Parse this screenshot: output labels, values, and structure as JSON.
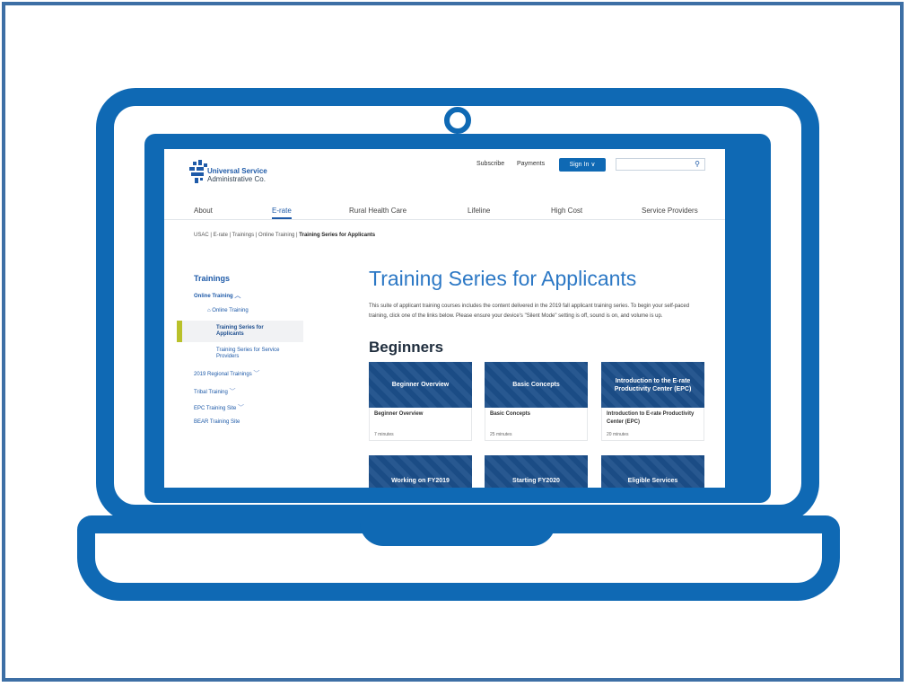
{
  "colors": {
    "brand_blue": "#0f69b4",
    "frame_blue": "#3d6fa5",
    "title_blue": "#2c78c5",
    "selected_accent": "#b9c12a"
  },
  "site": {
    "logo_line1": "Universal Service",
    "logo_line2": "Administrative Co.",
    "subscribe": "Subscribe",
    "payments": "Payments",
    "signin": "Sign In",
    "search_icon": "search-icon"
  },
  "nav": [
    "About",
    "E-rate",
    "Rural Health Care",
    "Lifeline",
    "High Cost",
    "Service Providers"
  ],
  "breadcrumb": {
    "trail": "USAC  |  E-rate  |  Trainings  |  Online Training  |",
    "current": "Training Series for Applicants"
  },
  "sidebar": {
    "heading": "Trainings",
    "items": [
      "Online Training",
      "Online Training",
      "Training Series for Applicants",
      "Training Series for Service Providers",
      "2019 Regional Trainings",
      "Tribal Training",
      "EPC Training Site",
      "BEAR Training Site"
    ]
  },
  "main": {
    "title": "Training Series for Applicants",
    "description": "This suite of applicant training courses includes the content delivered in the 2019 fall applicant training series. To begin your self-paced training, click one of the links below. Please ensure your device's \"Silent Mode\" setting is off, sound is on, and volume is up.",
    "section": "Beginners"
  },
  "cards": [
    {
      "image_label": "Beginner Overview",
      "title": "Beginner Overview",
      "meta": "7 minutes"
    },
    {
      "image_label": "Basic Concepts",
      "title": "Basic Concepts",
      "meta": "25 minutes"
    },
    {
      "image_label": "Introduction to the E-rate Productivity Center (EPC)",
      "title": "Introduction to E-rate Productivity Center (EPC)",
      "meta": "20 minutes"
    },
    {
      "image_label": "Working on FY2019"
    },
    {
      "image_label": "Starting FY2020"
    },
    {
      "image_label": "Eligible Services"
    }
  ]
}
